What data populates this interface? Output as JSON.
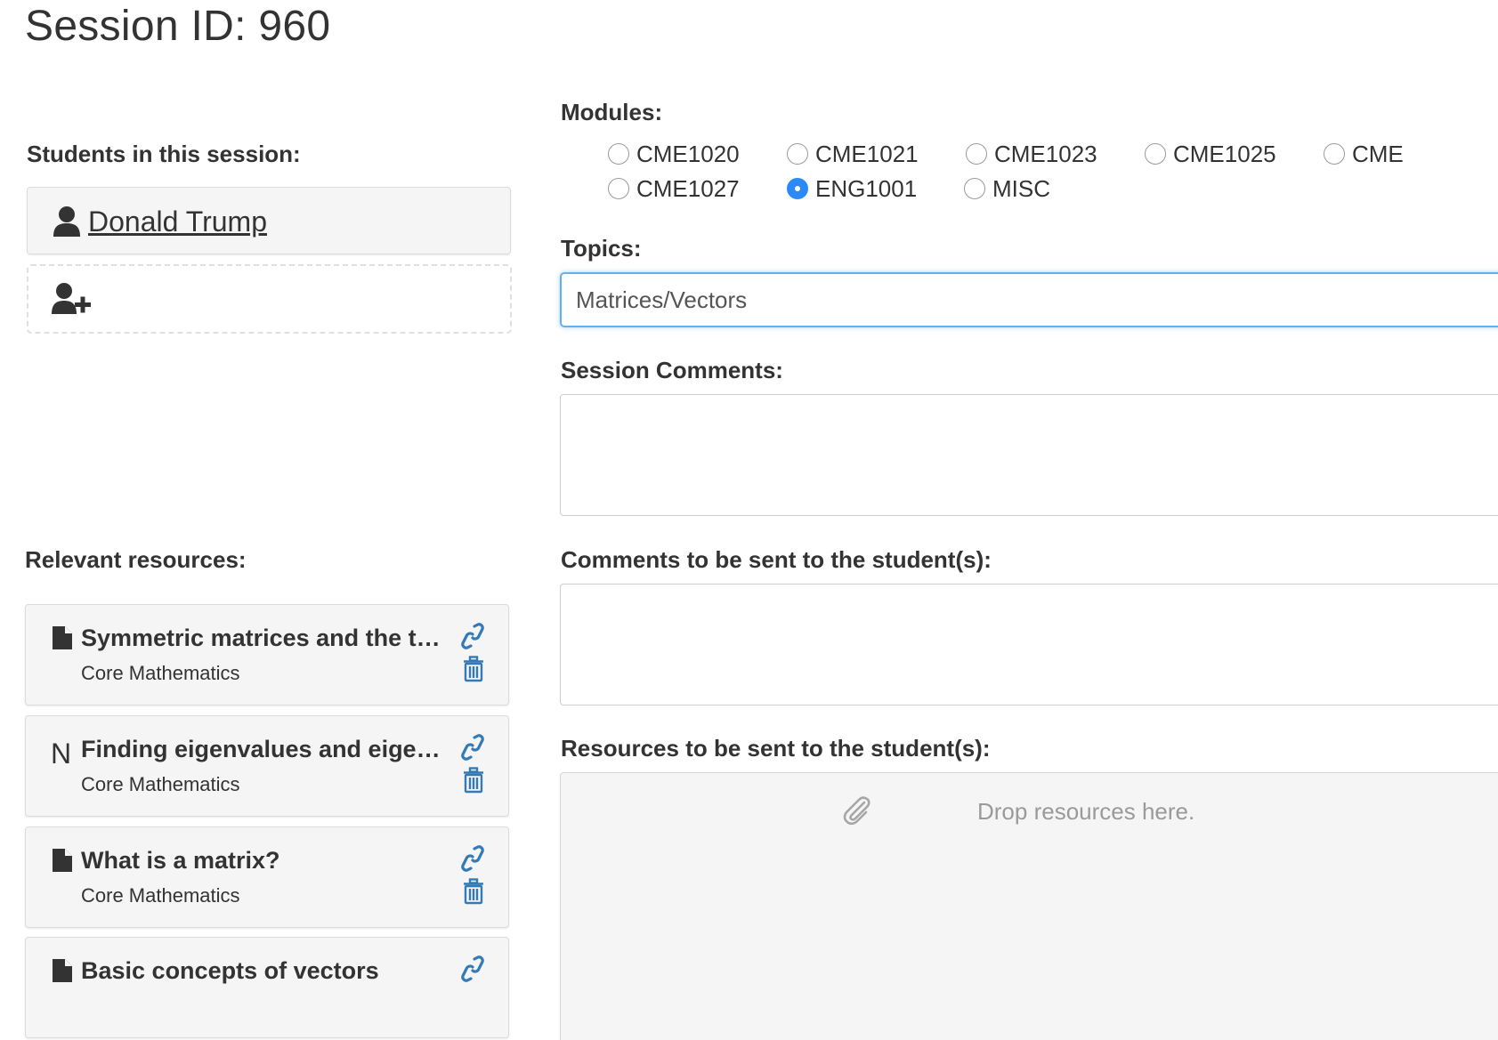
{
  "page": {
    "title": "Session ID: 960"
  },
  "students": {
    "label": "Students in this session:",
    "items": [
      {
        "name": "Donald Trump"
      }
    ]
  },
  "resources": {
    "label": "Relevant resources:",
    "items": [
      {
        "type_icon": "file-icon",
        "title": "Symmetric matrices and the tr…",
        "subject": "Core Mathematics"
      },
      {
        "type_icon": "notes-letter-icon",
        "type_letter": "N",
        "title": "Finding eigenvalues and eigen…",
        "subject": "Core Mathematics"
      },
      {
        "type_icon": "file-icon",
        "title": "What is a matrix?",
        "subject": "Core Mathematics"
      },
      {
        "type_icon": "file-icon",
        "title": "Basic concepts of vectors",
        "subject": ""
      }
    ]
  },
  "modules": {
    "label": "Modules:",
    "options": [
      {
        "label": "CME1020",
        "selected": false
      },
      {
        "label": "CME1021",
        "selected": false
      },
      {
        "label": "CME1023",
        "selected": false
      },
      {
        "label": "CME1025",
        "selected": false
      },
      {
        "label": "CME",
        "selected": false
      },
      {
        "label": "CME1027",
        "selected": false
      },
      {
        "label": "ENG1001",
        "selected": true
      },
      {
        "label": "MISC",
        "selected": false
      }
    ]
  },
  "topics": {
    "label": "Topics:",
    "value": "Matrices/Vectors"
  },
  "session_comments": {
    "label": "Session Comments:",
    "value": ""
  },
  "student_comments": {
    "label": "Comments to be sent to the student(s):",
    "value": ""
  },
  "resources_to_send": {
    "label": "Resources to be sent to the student(s):",
    "placeholder": "Drop resources here."
  },
  "colors": {
    "accent_blue": "#2b8af7",
    "link_blue": "#337ab7",
    "focus_border": "#66afe9",
    "card_background": "#f5f5f5",
    "text": "#333333",
    "muted_text": "#9a9a9a"
  }
}
